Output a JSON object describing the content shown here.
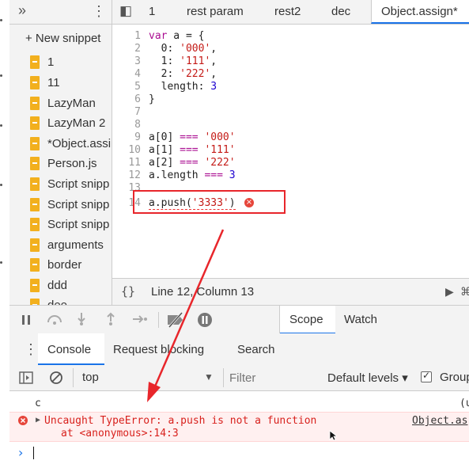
{
  "sidebar": {
    "more_glyph": "»",
    "menu_glyph": "⋮",
    "new_snippet_label": "+ New snippet",
    "files": [
      "1",
      "11",
      "LazyMan",
      "LazyMan 2",
      "*Object.assi",
      "Person.js",
      "Script snipp",
      "Script snipp",
      "Script snipp",
      "arguments",
      "border",
      "ddd",
      "dee"
    ]
  },
  "tabs": {
    "toggle_glyph": "◧",
    "items": [
      "1",
      "rest param",
      "rest2",
      "dec",
      "Object.assign*"
    ]
  },
  "editor": {
    "line_numbers": [
      "1",
      "2",
      "3",
      "4",
      "5",
      "6",
      "7",
      "8",
      "9",
      "10",
      "11",
      "12",
      "13",
      "14"
    ],
    "lines": {
      "l1_kw": "var",
      "l1_rest": " a = {",
      "l2_key": "  0: ",
      "l2_val": "'000'",
      "l2_end": ",",
      "l3_key": "  1: ",
      "l3_val": "'111'",
      "l3_end": ",",
      "l4_key": "  2: ",
      "l4_val": "'222'",
      "l4_end": ",",
      "l5_key": "  length: ",
      "l5_val": "3",
      "l6": "}",
      "l9_a": "a[0] ",
      "l9_op": "===",
      "l9_val": " '000'",
      "l10_a": "a[1] ",
      "l10_op": "===",
      "l10_val": " '111'",
      "l11_a": "a[2] ",
      "l11_op": "===",
      "l11_val": " '222'",
      "l12_a": "a.length ",
      "l12_op": "===",
      "l12_val": " 3",
      "l14_a": "a.push(",
      "l14_val": "'3333'",
      "l14_end": ")"
    }
  },
  "statusbar": {
    "braces": "{}",
    "position": "Line 12, Column 13",
    "play_glyph": "▶",
    "cmd_glyph": "⌘"
  },
  "debugger": {
    "scope_tab": "Scope",
    "watch_tab": "Watch"
  },
  "drawer": {
    "menu_glyph": "⋮",
    "tabs": [
      "Console",
      "Request blocking",
      "Search"
    ]
  },
  "console_toolbar": {
    "context": "top",
    "filter_placeholder": "Filter",
    "levels": "Default levels ▾",
    "group_label": "Group"
  },
  "console": {
    "prev_line": "c",
    "prev_source": "(u",
    "error_message": "Uncaught TypeError: a.push is not a function",
    "error_stack": "at <anonymous>:14:3",
    "error_source": "Object.as",
    "prompt": "›"
  },
  "colors": {
    "annotation_red": "#e8262b",
    "error_text": "#d8211d",
    "snippet_icon": "#f2b01e",
    "active_tab_underline": "#1a73e8"
  }
}
